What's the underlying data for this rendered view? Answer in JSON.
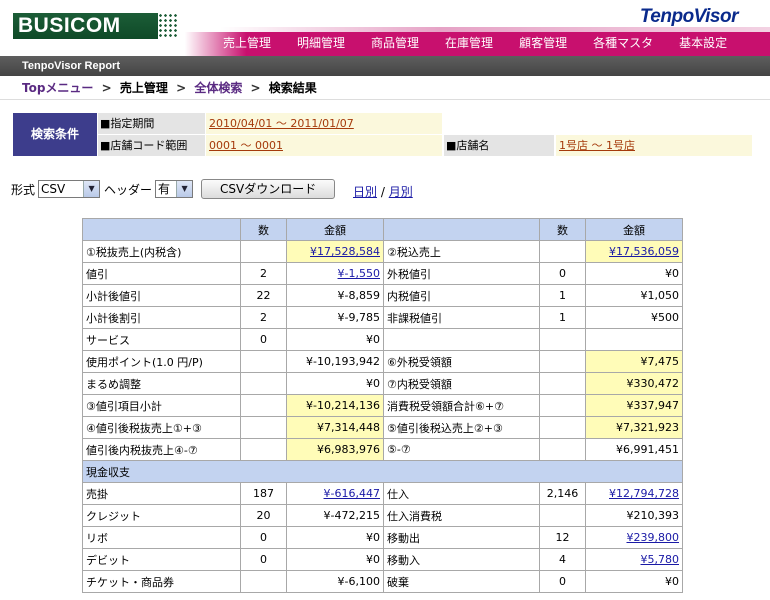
{
  "header": {
    "logo": "BUSICOM",
    "brand": "TenpoVisor",
    "nav": [
      "売上管理",
      "明細管理",
      "商品管理",
      "在庫管理",
      "顧客管理",
      "各種マスタ",
      "基本設定"
    ],
    "subtitle": "TenpoVisor Report"
  },
  "breadcrumb": {
    "top": "Topメニュー",
    "sales": "売上管理",
    "search": "全体検索",
    "result": "検索結果",
    "sep": ">"
  },
  "criteria": {
    "label": "検索条件",
    "period_key": "■指定期間",
    "period_val": "2010/04/01 〜 2011/01/07",
    "code_key": "■店舗コード範囲",
    "code_val": "0001 〜 0001",
    "store_key": "■店舗名",
    "store_val": "1号店 〜 1号店"
  },
  "controls": {
    "format_label": "形式",
    "format_value": "CSV",
    "header_label": "ヘッダー",
    "header_value": "有",
    "download_button": "CSVダウンロード",
    "daily": "日別",
    "slash": "/",
    "monthly": "月別"
  },
  "table": {
    "head": [
      "",
      "数",
      "金額",
      "",
      "数",
      "金額"
    ],
    "rows": [
      [
        "①税抜売上(内税含)",
        "",
        "¥17,528,584",
        "②税込売上",
        "",
        "¥17,536,059"
      ],
      [
        "値引",
        "2",
        "¥-1,550",
        "外税値引",
        "0",
        "¥0"
      ],
      [
        "小計後値引",
        "22",
        "¥-8,859",
        "内税値引",
        "1",
        "¥1,050"
      ],
      [
        "小計後割引",
        "2",
        "¥-9,785",
        "非課税値引",
        "1",
        "¥500"
      ],
      [
        "サービス",
        "0",
        "¥0",
        "",
        "",
        ""
      ],
      [
        "使用ポイント(1.0 円/P)",
        "",
        "¥-10,193,942",
        "⑥外税受領額",
        "",
        "¥7,475"
      ],
      [
        "まるめ調整",
        "",
        "¥0",
        "⑦内税受領額",
        "",
        "¥330,472"
      ],
      [
        "③値引項目小計",
        "",
        "¥-10,214,136",
        "消費税受領額合計⑥+⑦",
        "",
        "¥337,947"
      ],
      [
        "④値引後税抜売上①+③",
        "",
        "¥7,314,448",
        "⑤値引後税込売上②+③",
        "",
        "¥7,321,923"
      ],
      [
        "値引後内税抜売上④-⑦",
        "",
        "¥6,983,976",
        "⑤-⑦",
        "",
        "¥6,991,451"
      ]
    ],
    "section": "現金収支",
    "rows2": [
      [
        "売掛",
        "187",
        "¥-616,447",
        "仕入",
        "2,146",
        "¥12,794,728"
      ],
      [
        "クレジット",
        "20",
        "¥-472,215",
        "仕入消費税",
        "",
        "¥210,393"
      ],
      [
        "リボ",
        "0",
        "¥0",
        "移動出",
        "12",
        "¥239,800"
      ],
      [
        "デビット",
        "0",
        "¥0",
        "移動入",
        "4",
        "¥5,780"
      ],
      [
        "チケット・商品券",
        "",
        "¥-6,100",
        "破棄",
        "0",
        "¥0"
      ]
    ]
  },
  "colors": {
    "accent": "#c8106e",
    "criteria_label": "#3d3d8c",
    "header_cells": "#c3d3f0",
    "highlight": "#fffcb8"
  }
}
